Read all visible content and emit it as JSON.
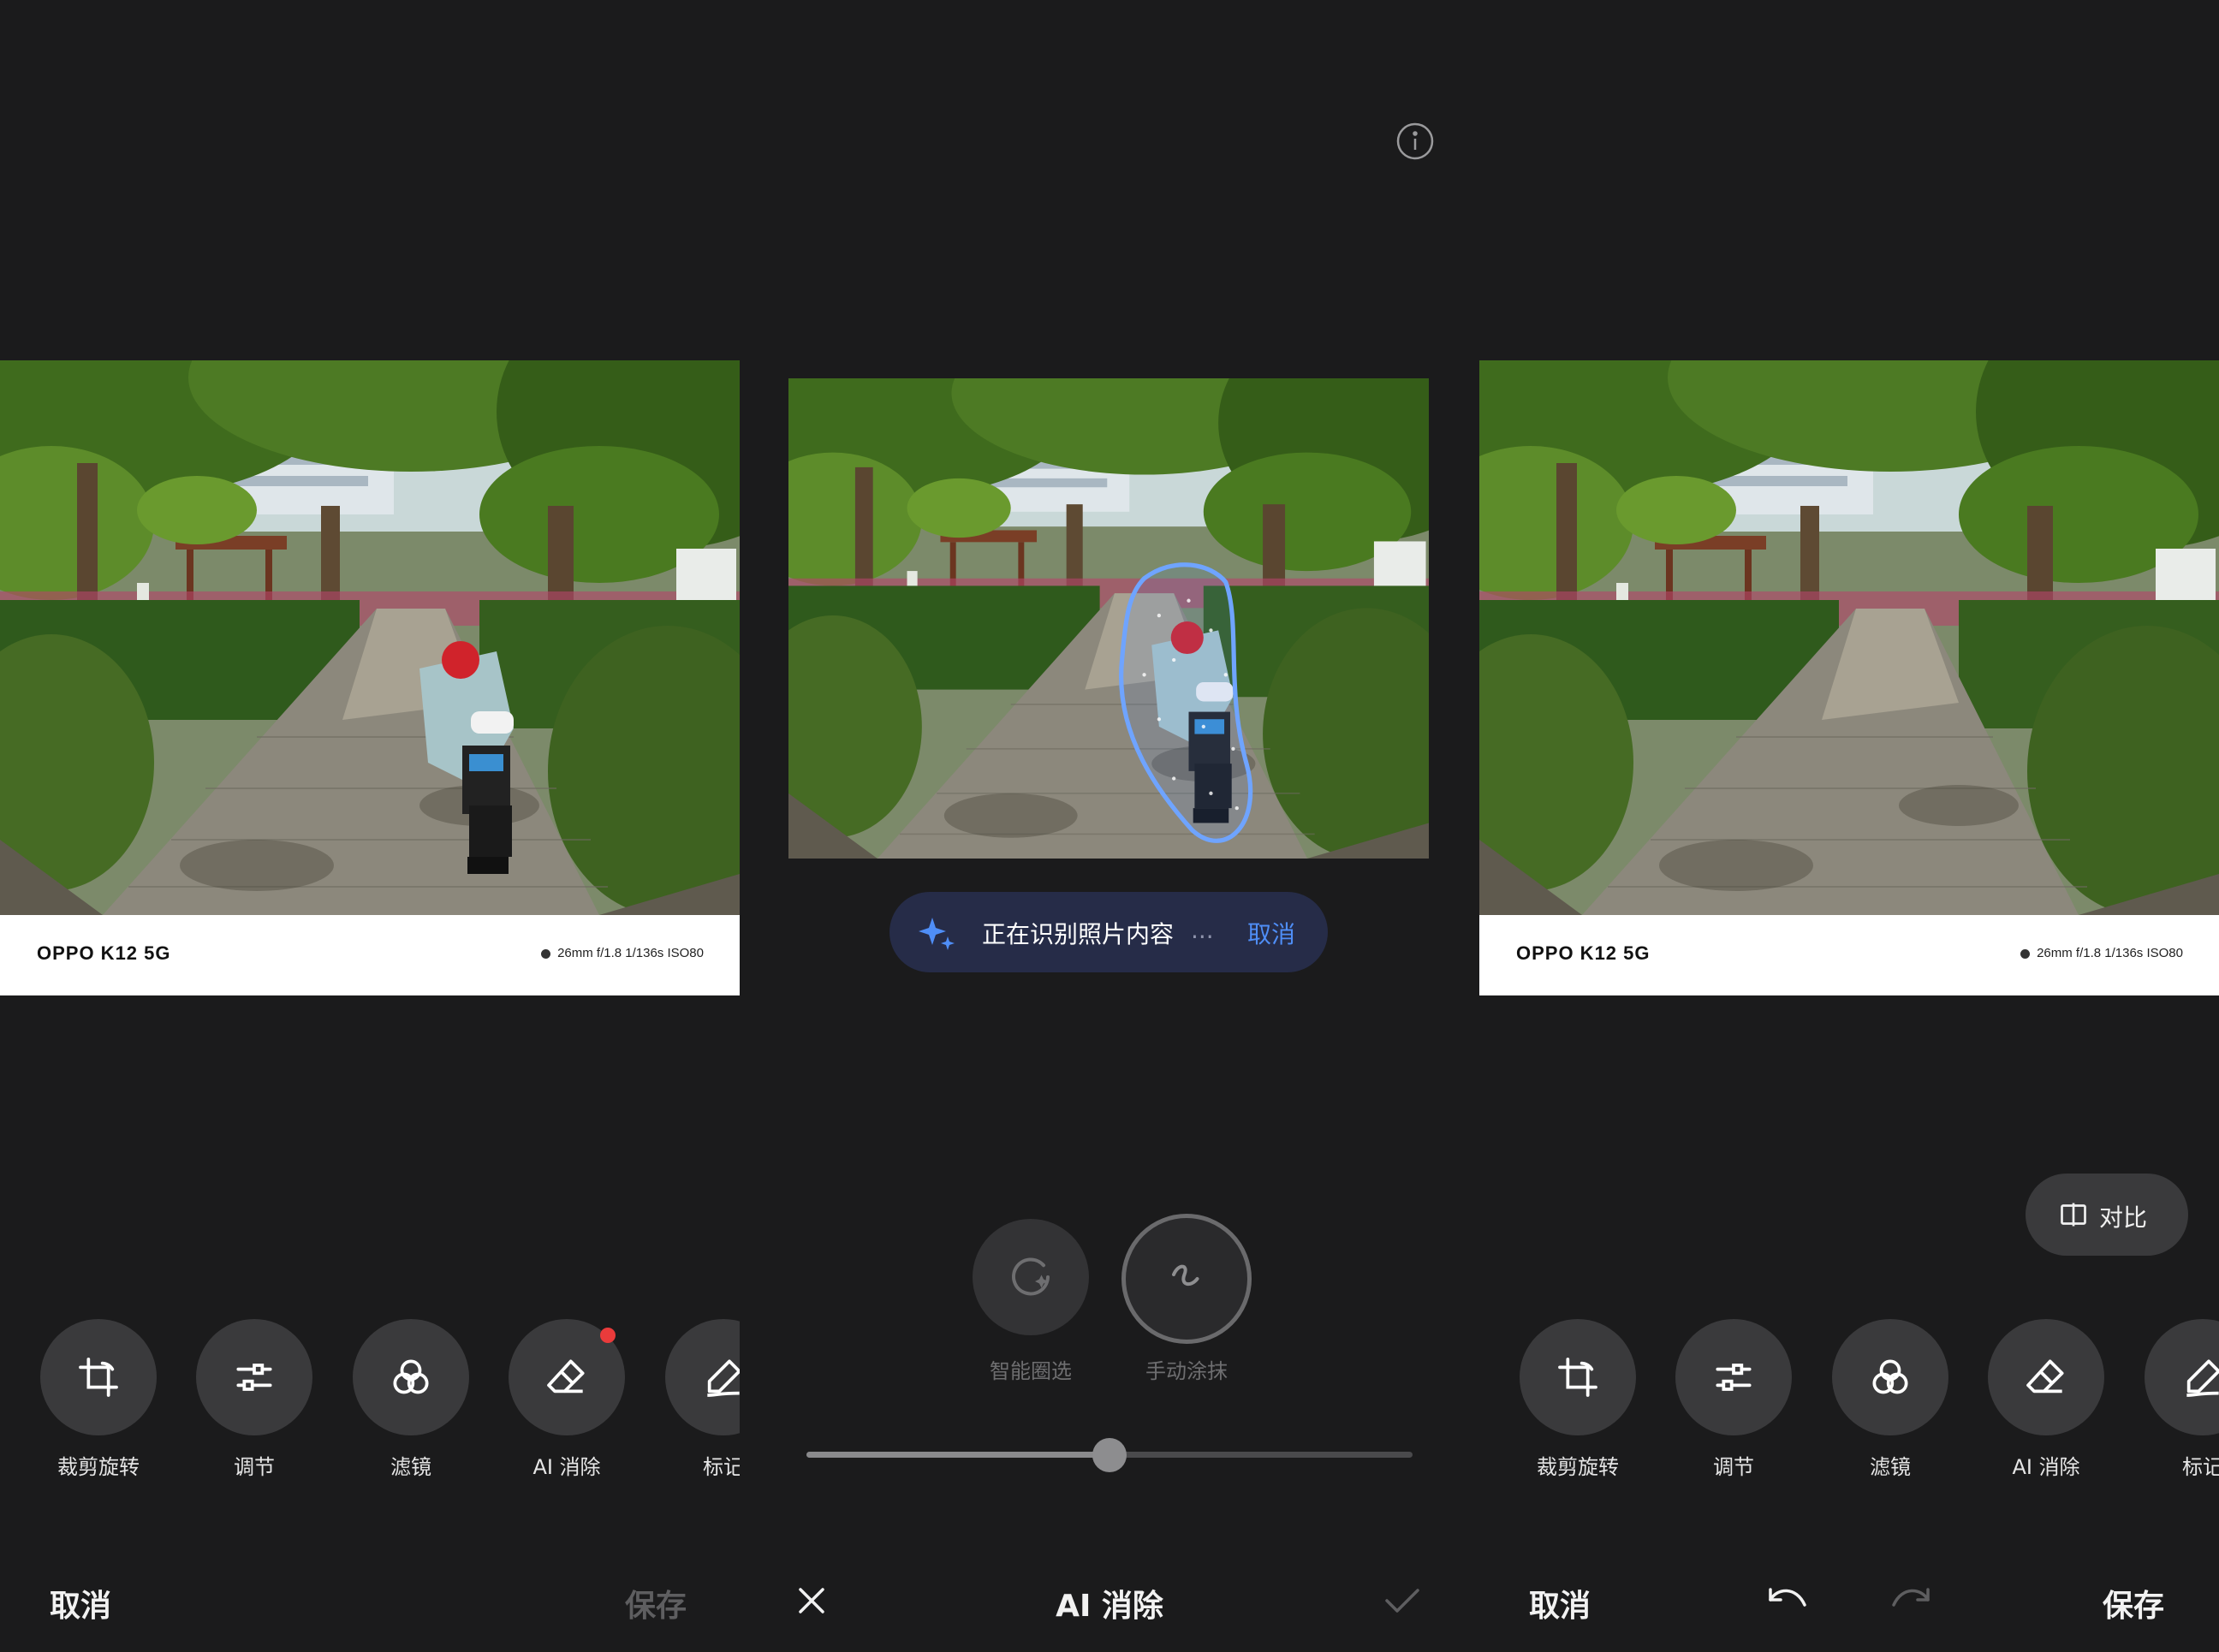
{
  "panel1": {
    "watermark": {
      "model": "OPPO K12 5G",
      "params": "26mm  f/1.8  1/136s  ISO80"
    },
    "tools": [
      {
        "label": "裁剪旋转",
        "icon": "crop-rotate-icon"
      },
      {
        "label": "调节",
        "icon": "adjust-sliders-icon"
      },
      {
        "label": "滤镜",
        "icon": "filter-icon"
      },
      {
        "label": "AI 消除",
        "icon": "eraser-icon",
        "badge": true
      },
      {
        "label": "标记",
        "icon": "markup-pen-icon"
      }
    ],
    "cancel_label": "取消",
    "save_label": "保存"
  },
  "panel2": {
    "toast": {
      "text": "正在识别照片内容",
      "dots": "...",
      "cancel": "取消"
    },
    "modes": [
      {
        "label": "智能圈选",
        "icon": "smart-select-icon"
      },
      {
        "label": "手动涂抹",
        "icon": "brush-icon",
        "selected": true
      }
    ],
    "brush_size": 0.5,
    "title": "AI 消除"
  },
  "panel3": {
    "watermark": {
      "model": "OPPO K12 5G",
      "params": "26mm  f/1.8  1/136s  ISO80"
    },
    "compare_label": "对比",
    "tools": [
      {
        "label": "裁剪旋转",
        "icon": "crop-rotate-icon"
      },
      {
        "label": "调节",
        "icon": "adjust-sliders-icon"
      },
      {
        "label": "滤镜",
        "icon": "filter-icon"
      },
      {
        "label": "AI 消除",
        "icon": "eraser-icon"
      },
      {
        "label": "标记",
        "icon": "markup-pen-icon"
      }
    ],
    "cancel_label": "取消",
    "save_label": "保存"
  },
  "colors": {
    "background": "#1b1b1c",
    "accent": "#4f8ef7",
    "badge": "#ea3b3b",
    "toast_bg": "#262c48"
  }
}
